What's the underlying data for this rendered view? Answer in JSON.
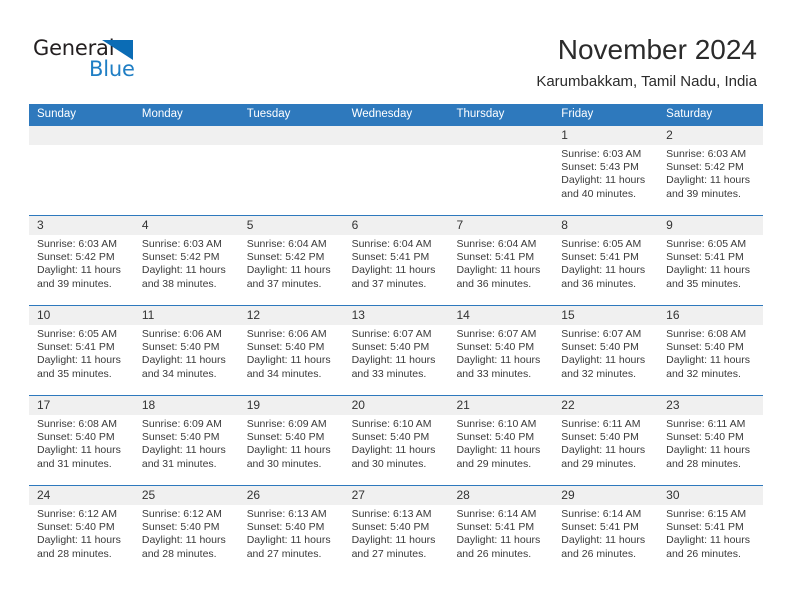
{
  "brand": {
    "name_part1": "General",
    "name_part2": "Blue",
    "accent_color": "#1f7ec4"
  },
  "header": {
    "title": "November 2024",
    "subtitle": "Karumbakkam, Tamil Nadu, India"
  },
  "calendar": {
    "header_color": "#2e79bd",
    "weekday_headers": [
      "Sunday",
      "Monday",
      "Tuesday",
      "Wednesday",
      "Thursday",
      "Friday",
      "Saturday"
    ],
    "weeks": [
      {
        "days": [
          {
            "num": "",
            "sunrise": "",
            "sunset": "",
            "daylight_line1": "",
            "daylight_line2": ""
          },
          {
            "num": "",
            "sunrise": "",
            "sunset": "",
            "daylight_line1": "",
            "daylight_line2": ""
          },
          {
            "num": "",
            "sunrise": "",
            "sunset": "",
            "daylight_line1": "",
            "daylight_line2": ""
          },
          {
            "num": "",
            "sunrise": "",
            "sunset": "",
            "daylight_line1": "",
            "daylight_line2": ""
          },
          {
            "num": "",
            "sunrise": "",
            "sunset": "",
            "daylight_line1": "",
            "daylight_line2": ""
          },
          {
            "num": "1",
            "sunrise": "Sunrise: 6:03 AM",
            "sunset": "Sunset: 5:43 PM",
            "daylight_line1": "Daylight: 11 hours",
            "daylight_line2": "and 40 minutes."
          },
          {
            "num": "2",
            "sunrise": "Sunrise: 6:03 AM",
            "sunset": "Sunset: 5:42 PM",
            "daylight_line1": "Daylight: 11 hours",
            "daylight_line2": "and 39 minutes."
          }
        ]
      },
      {
        "days": [
          {
            "num": "3",
            "sunrise": "Sunrise: 6:03 AM",
            "sunset": "Sunset: 5:42 PM",
            "daylight_line1": "Daylight: 11 hours",
            "daylight_line2": "and 39 minutes."
          },
          {
            "num": "4",
            "sunrise": "Sunrise: 6:03 AM",
            "sunset": "Sunset: 5:42 PM",
            "daylight_line1": "Daylight: 11 hours",
            "daylight_line2": "and 38 minutes."
          },
          {
            "num": "5",
            "sunrise": "Sunrise: 6:04 AM",
            "sunset": "Sunset: 5:42 PM",
            "daylight_line1": "Daylight: 11 hours",
            "daylight_line2": "and 37 minutes."
          },
          {
            "num": "6",
            "sunrise": "Sunrise: 6:04 AM",
            "sunset": "Sunset: 5:41 PM",
            "daylight_line1": "Daylight: 11 hours",
            "daylight_line2": "and 37 minutes."
          },
          {
            "num": "7",
            "sunrise": "Sunrise: 6:04 AM",
            "sunset": "Sunset: 5:41 PM",
            "daylight_line1": "Daylight: 11 hours",
            "daylight_line2": "and 36 minutes."
          },
          {
            "num": "8",
            "sunrise": "Sunrise: 6:05 AM",
            "sunset": "Sunset: 5:41 PM",
            "daylight_line1": "Daylight: 11 hours",
            "daylight_line2": "and 36 minutes."
          },
          {
            "num": "9",
            "sunrise": "Sunrise: 6:05 AM",
            "sunset": "Sunset: 5:41 PM",
            "daylight_line1": "Daylight: 11 hours",
            "daylight_line2": "and 35 minutes."
          }
        ]
      },
      {
        "days": [
          {
            "num": "10",
            "sunrise": "Sunrise: 6:05 AM",
            "sunset": "Sunset: 5:41 PM",
            "daylight_line1": "Daylight: 11 hours",
            "daylight_line2": "and 35 minutes."
          },
          {
            "num": "11",
            "sunrise": "Sunrise: 6:06 AM",
            "sunset": "Sunset: 5:40 PM",
            "daylight_line1": "Daylight: 11 hours",
            "daylight_line2": "and 34 minutes."
          },
          {
            "num": "12",
            "sunrise": "Sunrise: 6:06 AM",
            "sunset": "Sunset: 5:40 PM",
            "daylight_line1": "Daylight: 11 hours",
            "daylight_line2": "and 34 minutes."
          },
          {
            "num": "13",
            "sunrise": "Sunrise: 6:07 AM",
            "sunset": "Sunset: 5:40 PM",
            "daylight_line1": "Daylight: 11 hours",
            "daylight_line2": "and 33 minutes."
          },
          {
            "num": "14",
            "sunrise": "Sunrise: 6:07 AM",
            "sunset": "Sunset: 5:40 PM",
            "daylight_line1": "Daylight: 11 hours",
            "daylight_line2": "and 33 minutes."
          },
          {
            "num": "15",
            "sunrise": "Sunrise: 6:07 AM",
            "sunset": "Sunset: 5:40 PM",
            "daylight_line1": "Daylight: 11 hours",
            "daylight_line2": "and 32 minutes."
          },
          {
            "num": "16",
            "sunrise": "Sunrise: 6:08 AM",
            "sunset": "Sunset: 5:40 PM",
            "daylight_line1": "Daylight: 11 hours",
            "daylight_line2": "and 32 minutes."
          }
        ]
      },
      {
        "days": [
          {
            "num": "17",
            "sunrise": "Sunrise: 6:08 AM",
            "sunset": "Sunset: 5:40 PM",
            "daylight_line1": "Daylight: 11 hours",
            "daylight_line2": "and 31 minutes."
          },
          {
            "num": "18",
            "sunrise": "Sunrise: 6:09 AM",
            "sunset": "Sunset: 5:40 PM",
            "daylight_line1": "Daylight: 11 hours",
            "daylight_line2": "and 31 minutes."
          },
          {
            "num": "19",
            "sunrise": "Sunrise: 6:09 AM",
            "sunset": "Sunset: 5:40 PM",
            "daylight_line1": "Daylight: 11 hours",
            "daylight_line2": "and 30 minutes."
          },
          {
            "num": "20",
            "sunrise": "Sunrise: 6:10 AM",
            "sunset": "Sunset: 5:40 PM",
            "daylight_line1": "Daylight: 11 hours",
            "daylight_line2": "and 30 minutes."
          },
          {
            "num": "21",
            "sunrise": "Sunrise: 6:10 AM",
            "sunset": "Sunset: 5:40 PM",
            "daylight_line1": "Daylight: 11 hours",
            "daylight_line2": "and 29 minutes."
          },
          {
            "num": "22",
            "sunrise": "Sunrise: 6:11 AM",
            "sunset": "Sunset: 5:40 PM",
            "daylight_line1": "Daylight: 11 hours",
            "daylight_line2": "and 29 minutes."
          },
          {
            "num": "23",
            "sunrise": "Sunrise: 6:11 AM",
            "sunset": "Sunset: 5:40 PM",
            "daylight_line1": "Daylight: 11 hours",
            "daylight_line2": "and 28 minutes."
          }
        ]
      },
      {
        "days": [
          {
            "num": "24",
            "sunrise": "Sunrise: 6:12 AM",
            "sunset": "Sunset: 5:40 PM",
            "daylight_line1": "Daylight: 11 hours",
            "daylight_line2": "and 28 minutes."
          },
          {
            "num": "25",
            "sunrise": "Sunrise: 6:12 AM",
            "sunset": "Sunset: 5:40 PM",
            "daylight_line1": "Daylight: 11 hours",
            "daylight_line2": "and 28 minutes."
          },
          {
            "num": "26",
            "sunrise": "Sunrise: 6:13 AM",
            "sunset": "Sunset: 5:40 PM",
            "daylight_line1": "Daylight: 11 hours",
            "daylight_line2": "and 27 minutes."
          },
          {
            "num": "27",
            "sunrise": "Sunrise: 6:13 AM",
            "sunset": "Sunset: 5:40 PM",
            "daylight_line1": "Daylight: 11 hours",
            "daylight_line2": "and 27 minutes."
          },
          {
            "num": "28",
            "sunrise": "Sunrise: 6:14 AM",
            "sunset": "Sunset: 5:41 PM",
            "daylight_line1": "Daylight: 11 hours",
            "daylight_line2": "and 26 minutes."
          },
          {
            "num": "29",
            "sunrise": "Sunrise: 6:14 AM",
            "sunset": "Sunset: 5:41 PM",
            "daylight_line1": "Daylight: 11 hours",
            "daylight_line2": "and 26 minutes."
          },
          {
            "num": "30",
            "sunrise": "Sunrise: 6:15 AM",
            "sunset": "Sunset: 5:41 PM",
            "daylight_line1": "Daylight: 11 hours",
            "daylight_line2": "and 26 minutes."
          }
        ]
      }
    ]
  }
}
